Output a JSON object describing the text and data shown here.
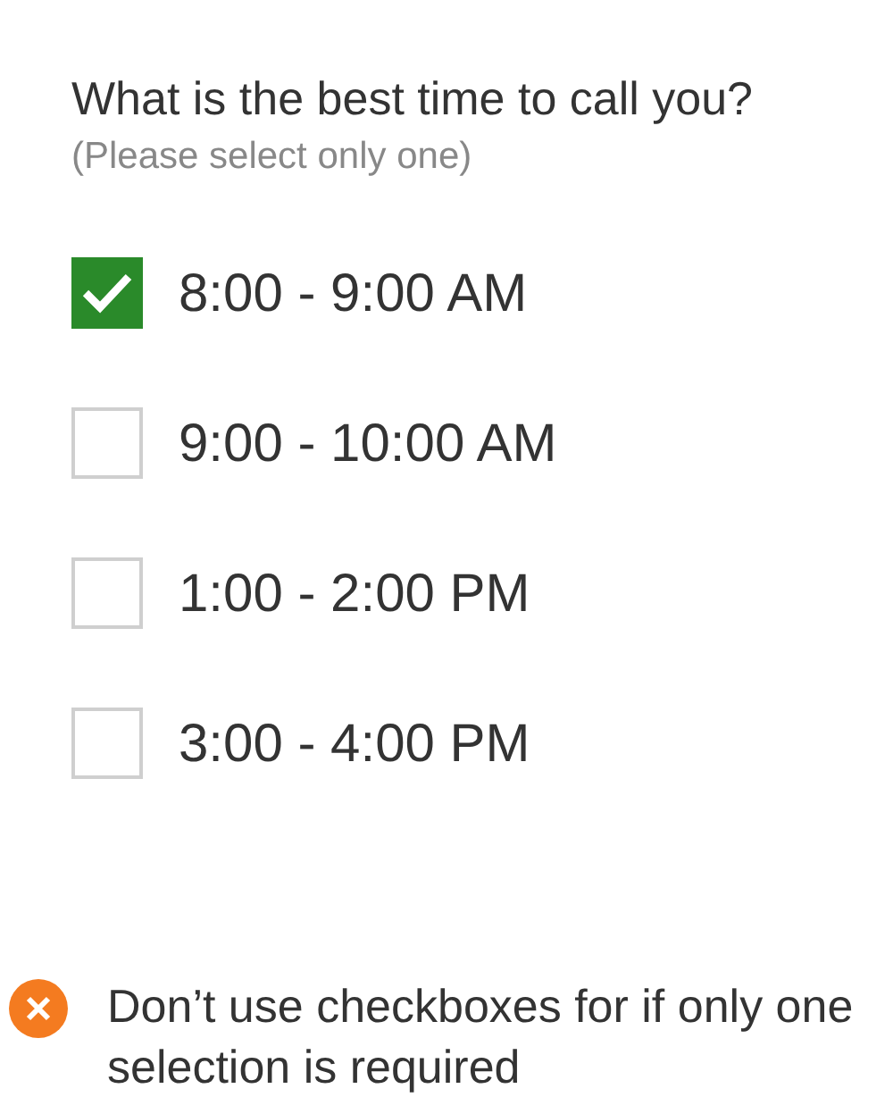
{
  "question": {
    "title": "What is the best time to call you?",
    "hint": "(Please select only one)"
  },
  "options": [
    {
      "label": "8:00 - 9:00 AM",
      "checked": true
    },
    {
      "label": "9:00 - 10:00 AM",
      "checked": false
    },
    {
      "label": "1:00 - 2:00 PM",
      "checked": false
    },
    {
      "label": "3:00 - 4:00 PM",
      "checked": false
    }
  ],
  "note": {
    "kind": "dont",
    "text": "Don’t use checkboxes for if only one selection is required"
  }
}
